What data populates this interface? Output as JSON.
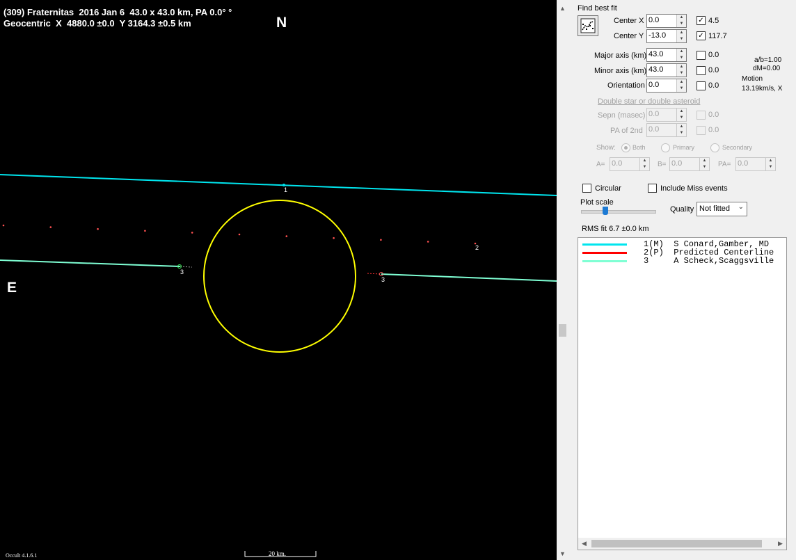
{
  "plot": {
    "title_line1": "(309) Fraternitas  2016 Jan 6  43.0 x 43.0 km, PA 0.0° °",
    "title_line2": "Geocentric  X  4880.0 ±0.0  Y 3164.3 ±0.5 km",
    "north_label": "N",
    "east_label": "E",
    "chord_labels": [
      "1",
      "2",
      "3",
      "3"
    ],
    "version": "Occult 4.1.6.1",
    "scale_label": "20 km.",
    "colors": {
      "background": "#000000",
      "ellipse": "#ffff00",
      "chord1": "#00e5ee",
      "chord3": "#7fffd4",
      "predicted_points": "#ff5050"
    }
  },
  "panel": {
    "find_best_fit": "Find best fit",
    "fit_button_icon": "fit-chart-icon",
    "center_x": {
      "label": "Center X",
      "value": "0.0",
      "checked": true,
      "result": "4.5"
    },
    "center_y": {
      "label": "Center Y",
      "value": "-13.0",
      "checked": true,
      "result": "117.7"
    },
    "major_axis": {
      "label": "Major axis (km)",
      "value": "43.0",
      "checked": false,
      "result": "0.0"
    },
    "minor_axis": {
      "label": "Minor axis (km)",
      "value": "43.0",
      "checked": false,
      "result": "0.0"
    },
    "orientation": {
      "label": "Orientation",
      "value": "0.0",
      "checked": false,
      "result": "0.0"
    },
    "ab_ratio": "a/b=1.00",
    "dm": "dM=0.00",
    "motion_label": "Motion",
    "motion_value": "13.19km/s, X",
    "double_star_link": "Double star  or  double asteroid",
    "sepn": {
      "label": "Sepn (masec)",
      "value": "0.0",
      "result": "0.0"
    },
    "pa_2nd": {
      "label": "PA of 2nd",
      "value": "0.0",
      "result": "0.0"
    },
    "show_label": "Show:",
    "show_options": [
      "Both",
      "Primary",
      "Secondary"
    ],
    "show_selected": "Both",
    "a_field": {
      "label": "A=",
      "value": "0.0"
    },
    "b_field": {
      "label": "B=",
      "value": "0.0"
    },
    "pa_field": {
      "label": "PA=",
      "value": "0.0"
    },
    "circular_label": "Circular",
    "include_miss_label": "Include Miss events",
    "plot_scale_label": "Plot scale",
    "quality_label": "Quality",
    "quality_value": "Not fitted",
    "rms_fit": "RMS fit 6.7 ±0.0 km",
    "events": [
      {
        "color": "#00e5ee",
        "text": "1(M)  S Conard,Gamber, MD"
      },
      {
        "color": "#ff0000",
        "text": "2(P)  Predicted Centerline"
      },
      {
        "color": "#7fffd4",
        "text": "3     A Scheck,Scaggsville"
      }
    ]
  }
}
